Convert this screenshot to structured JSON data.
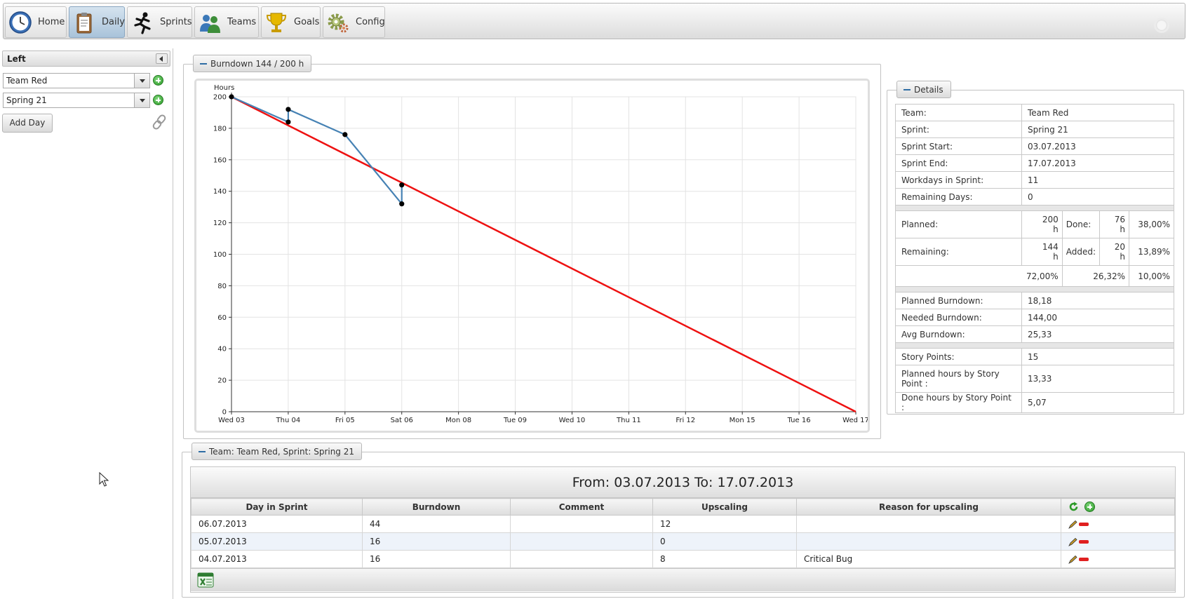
{
  "toolbar": {
    "buttons": [
      {
        "label": "Home",
        "icon": "clock-icon",
        "active": false
      },
      {
        "label": "Daily",
        "icon": "clipboard-icon",
        "active": true
      },
      {
        "label": "Sprints",
        "icon": "runner-icon",
        "active": false
      },
      {
        "label": "Teams",
        "icon": "people-icon",
        "active": false
      },
      {
        "label": "Goals",
        "icon": "trophy-icon",
        "active": false
      },
      {
        "label": "Config",
        "icon": "gear-icon",
        "active": false
      }
    ]
  },
  "left": {
    "title": "Left",
    "team_select": "Team Red",
    "sprint_select": "Spring 21",
    "add_day_label": "Add Day"
  },
  "burndown": {
    "legend": "Burndown 144 / 200 h"
  },
  "chart_data": {
    "type": "line",
    "ylabel": "Hours",
    "ylim": [
      0,
      200
    ],
    "yticks": [
      0,
      20,
      40,
      60,
      80,
      100,
      120,
      140,
      160,
      180,
      200
    ],
    "x_labels": [
      "Wed 03",
      "Thu 04",
      "Fri 05",
      "Sat 06",
      "Mon 08",
      "Tue 09",
      "Wed 10",
      "Thu 11",
      "Fri 12",
      "Mon 15",
      "Tue 16",
      "Wed 17"
    ],
    "series": [
      {
        "color": "#ee1111",
        "points": [
          [
            0,
            200
          ],
          [
            11,
            0
          ]
        ]
      },
      {
        "color": "#4682b4",
        "markers": true,
        "points": [
          [
            0,
            200
          ],
          [
            1,
            184
          ],
          [
            1,
            192
          ],
          [
            2,
            176
          ],
          [
            3,
            132
          ],
          [
            3,
            144
          ]
        ]
      }
    ]
  },
  "details": {
    "legend": "Details",
    "rows": [
      {
        "label": "Team:",
        "value": "Team Red"
      },
      {
        "label": "Sprint:",
        "value": "Spring 21"
      },
      {
        "label": "Sprint Start:",
        "value": "03.07.2013"
      },
      {
        "label": "Sprint End:",
        "value": "17.07.2013"
      },
      {
        "label": "Workdays in Sprint:",
        "value": "11"
      },
      {
        "label": "Remaining Days:",
        "value": "0"
      }
    ],
    "planned_label": "Planned:",
    "planned_value": "200",
    "planned_unit": "h",
    "done_label": "Done:",
    "done_value": "76",
    "done_unit": "h",
    "done_pct": "38,00%",
    "remaining_label": "Remaining:",
    "remaining_value": "144",
    "remaining_unit": "h",
    "added_label": "Added:",
    "added_value": "20",
    "added_unit": "h",
    "added_pct": "13,89%",
    "pct_row": [
      "72,00%",
      "26,32%",
      "10,00%"
    ],
    "burndown_rows": [
      {
        "label": "Planned Burndown:",
        "value": "18,18"
      },
      {
        "label": "Needed Burndown:",
        "value": "144,00"
      },
      {
        "label": "Avg Burndown:",
        "value": "25,33"
      }
    ],
    "story_rows": [
      {
        "label": "Story Points:",
        "value": "15"
      },
      {
        "label": "Planned hours by Story Point :",
        "value": "13,33"
      },
      {
        "label": "Done hours by Story Point :",
        "value": "5,07"
      }
    ]
  },
  "team_section": {
    "legend": "Team: Team Red, Sprint: Spring 21",
    "title": "From: 03.07.2013 To: 17.07.2013",
    "columns": [
      "Day in Sprint",
      "Burndown",
      "Comment",
      "Upscaling",
      "Reason for upscaling"
    ],
    "rows": [
      {
        "day": "06.07.2013",
        "burndown": "44",
        "comment": "",
        "upscaling": "12",
        "reason": ""
      },
      {
        "day": "05.07.2013",
        "burndown": "16",
        "comment": "",
        "upscaling": "0",
        "reason": ""
      },
      {
        "day": "04.07.2013",
        "burndown": "16",
        "comment": "",
        "upscaling": "8",
        "reason": "Critical Bug"
      }
    ]
  }
}
